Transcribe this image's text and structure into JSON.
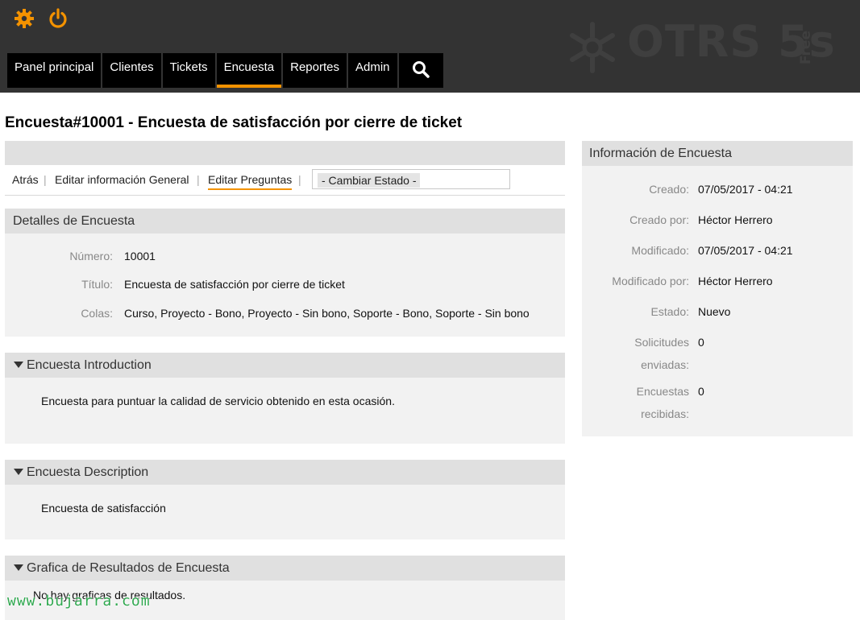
{
  "header": {
    "logo_text": "OTRS 5s",
    "logo_free": "Free",
    "nav": [
      {
        "label": "Panel principal",
        "active": false
      },
      {
        "label": "Clientes",
        "active": false
      },
      {
        "label": "Tickets",
        "active": false
      },
      {
        "label": "Encuesta",
        "active": true
      },
      {
        "label": "Reportes",
        "active": false
      },
      {
        "label": "Admin",
        "active": false
      }
    ],
    "icons": {
      "preferences": "gear-icon",
      "logout": "power-icon",
      "search": "search-icon"
    }
  },
  "page": {
    "title": "Encuesta#10001 - Encuesta de satisfacción por cierre de ticket"
  },
  "actions": {
    "back": "Atrás",
    "edit_general": "Editar información General",
    "edit_questions": "Editar Preguntas",
    "separator": "|",
    "state_select": "- Cambiar Estado -"
  },
  "details": {
    "title": "Detalles de Encuesta",
    "rows": [
      {
        "label": "Número:",
        "value": "10001"
      },
      {
        "label": "Título:",
        "value": "Encuesta de satisfacción por cierre de ticket"
      },
      {
        "label": "Colas:",
        "value": "Curso, Proyecto - Bono, Proyecto - Sin bono, Soporte - Bono, Soporte - Sin bono"
      }
    ]
  },
  "intro": {
    "title": "Encuesta Introduction",
    "body": "Encuesta para puntuar la calidad de servicio obtenido en esta ocasión."
  },
  "description": {
    "title": "Encuesta Description",
    "body": "Encuesta de satisfacción"
  },
  "graph": {
    "title": "Grafica de Resultados de Encuesta",
    "body": "No hay graficas de resultados."
  },
  "info": {
    "title": "Información de Encuesta",
    "rows": [
      {
        "label": "Creado:",
        "value": "07/05/2017 - 04:21"
      },
      {
        "label": "Creado por:",
        "value": "Héctor Herrero"
      },
      {
        "label": "Modificado:",
        "value": "07/05/2017 - 04:21"
      },
      {
        "label": "Modificado por:",
        "value": "Héctor Herrero"
      },
      {
        "label": "Estado:",
        "value": "Nuevo"
      },
      {
        "label_line1": "Solicitudes",
        "label_line2": "enviadas:",
        "value": "0"
      },
      {
        "label_line1": "Encuestas",
        "label_line2": "recibidas:",
        "value": "0"
      }
    ]
  },
  "colors": {
    "header_bg": "#333333",
    "accent": "#f39200",
    "widget_bg": "#f2f2f2",
    "widget_header_bg": "#e0e0e0"
  },
  "watermark": "www.bujarra.com"
}
